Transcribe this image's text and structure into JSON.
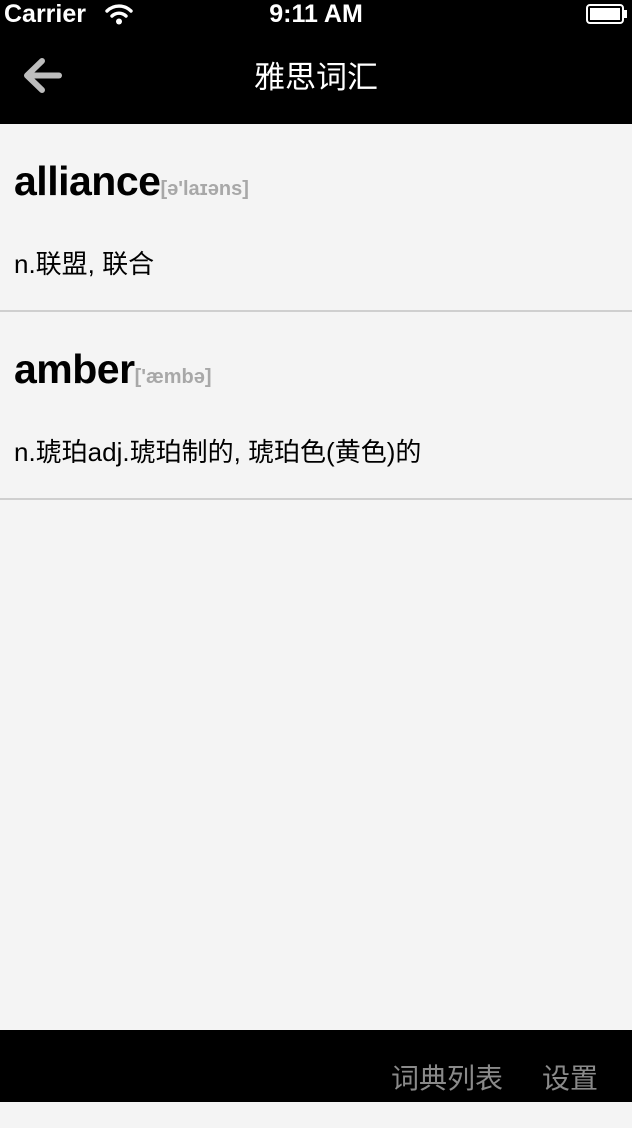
{
  "status_bar": {
    "carrier": "Carrier",
    "time": "9:11 AM"
  },
  "nav": {
    "title": "雅思词汇",
    "back_icon": "back-arrow-icon"
  },
  "words": [
    {
      "word": "alliance",
      "phonetic": "[ə'laɪəns]",
      "meaning": "n.联盟, 联合"
    },
    {
      "word": "amber",
      "phonetic": "['æmbə]",
      "meaning": "n.琥珀adj.琥珀制的, 琥珀色(黄色)的"
    }
  ],
  "tabbar": {
    "items": [
      {
        "label": "词典列表"
      },
      {
        "label": "设置"
      }
    ]
  },
  "colors": {
    "bar_background": "#000000",
    "content_background": "#f4f4f4",
    "phonetic_gray": "#a8a8a8",
    "tab_gray": "#8a8a8a",
    "divider": "#cfcfcf"
  }
}
